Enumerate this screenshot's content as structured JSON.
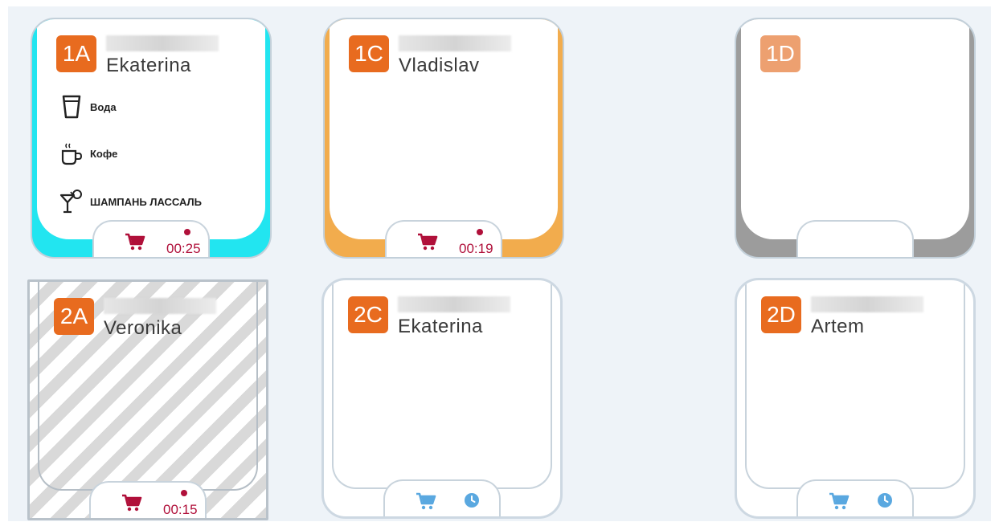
{
  "colors": {
    "badge": "#e86b1f",
    "badge_empty": "#eda070",
    "frame_cyan": "#22e5f0",
    "frame_orange": "#f2ac4d",
    "frame_gray": "#9c9c9c",
    "alert": "#b0103a",
    "idle_icon": "#5aa8e0"
  },
  "seats": {
    "s1A": {
      "label": "1A",
      "name": "Ekaterina",
      "timer": "00:25",
      "orders": [
        {
          "icon": "glass-icon",
          "label": "Вода"
        },
        {
          "icon": "coffee-cup-icon",
          "label": "Кофе"
        },
        {
          "icon": "cocktail-icon",
          "label": "ШАМПАНЬ ЛАССАЛЬ"
        }
      ]
    },
    "s1C": {
      "label": "1C",
      "name": "Vladislav",
      "timer": "00:19"
    },
    "s1D": {
      "label": "1D"
    },
    "s2A": {
      "label": "2A",
      "name": "Veronika",
      "timer": "00:15"
    },
    "s2C": {
      "label": "2C",
      "name": "Ekaterina"
    },
    "s2D": {
      "label": "2D",
      "name": "Artem"
    }
  }
}
